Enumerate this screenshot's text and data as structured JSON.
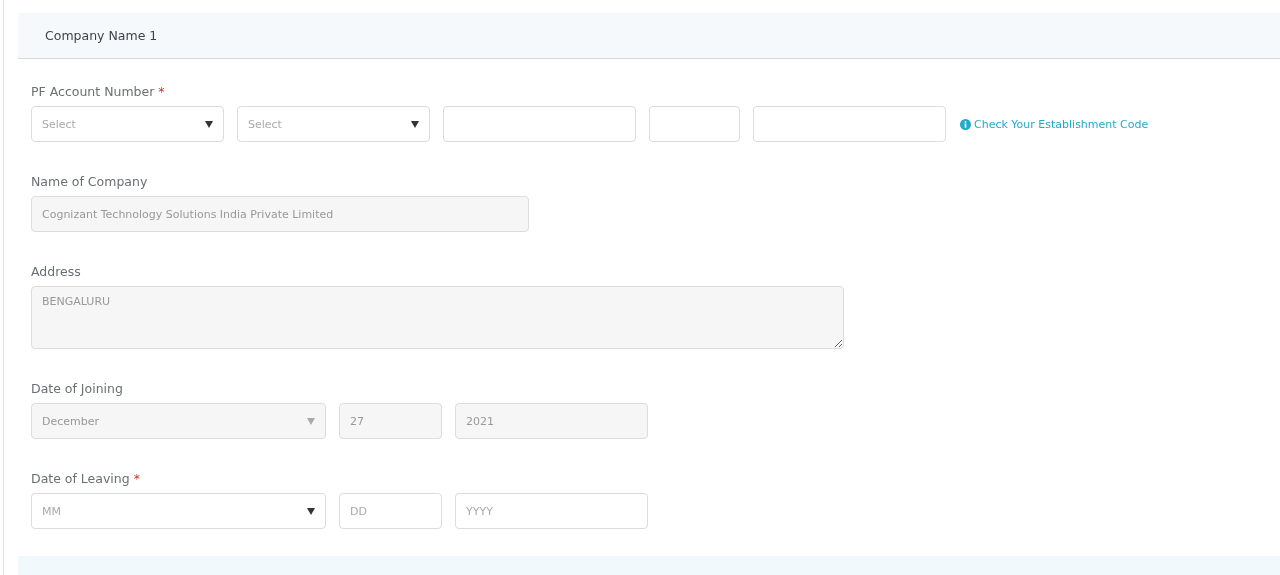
{
  "section": {
    "title": "Company Name 1"
  },
  "pf_account": {
    "label": "PF Account Number",
    "required_mark": "*",
    "fields": [
      {
        "kind": "select",
        "placeholder": "Select"
      },
      {
        "kind": "select",
        "placeholder": "Select"
      },
      {
        "kind": "text"
      },
      {
        "kind": "text"
      },
      {
        "kind": "text"
      }
    ],
    "help_link": "Check Your Establishment Code"
  },
  "name_of_company": {
    "label": "Name of Company",
    "value": "Cognizant Technology Solutions India Private Limited",
    "disabled": true
  },
  "address": {
    "label": "Address",
    "value": "BENGALURU",
    "disabled": true
  },
  "dates": [
    {
      "label": "Date of Joining",
      "disabled": true,
      "month": {
        "value": "December"
      },
      "day": {
        "value": "27"
      },
      "year": {
        "value": "2021"
      }
    },
    {
      "label": "Date of Leaving",
      "required_mark": "*",
      "disabled": false,
      "month": {
        "placeholder": "MM"
      },
      "day": {
        "placeholder": "DD"
      },
      "year": {
        "placeholder": "YYYY"
      }
    }
  ]
}
